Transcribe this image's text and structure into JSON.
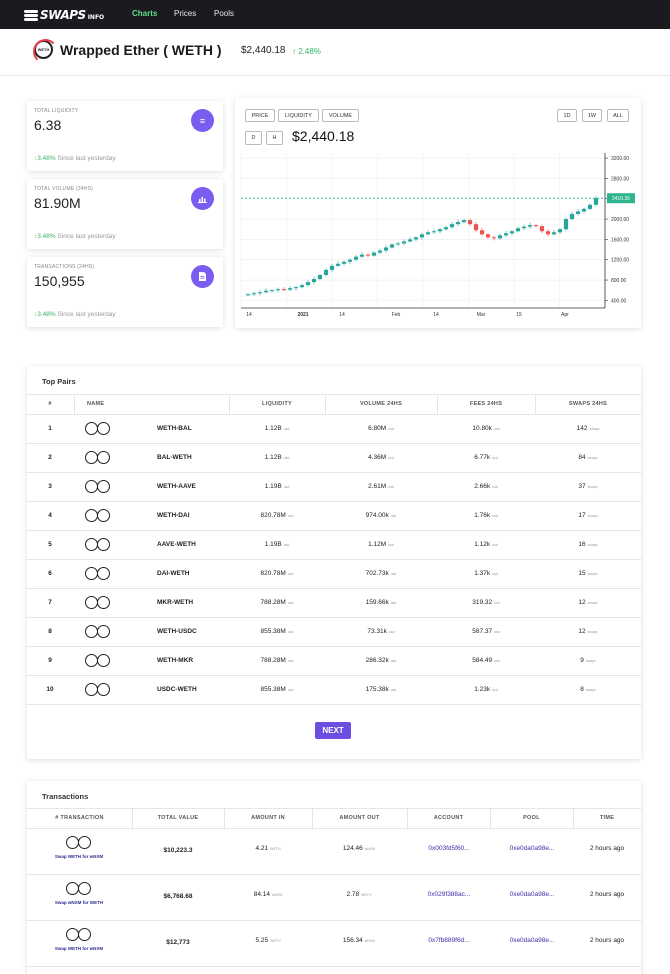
{
  "nav": {
    "brand": "SWAPS",
    "brand_sub": "INFO",
    "links": [
      "Charts",
      "Prices",
      "Pools"
    ]
  },
  "token": {
    "name": "Wrapped Ether ( WETH )",
    "logo_text": "WETH",
    "price": "$2,440.18",
    "change": "2.48%"
  },
  "stats": [
    {
      "label": "TOTAL LIQUIDITY",
      "value": "6.38",
      "delta": "3.48%",
      "since": "Since last yesterday",
      "icon": "menu-icon"
    },
    {
      "label": "TOTAL VOLUME (24HS)",
      "value": "81.90M",
      "delta": "3.48%",
      "since": "Since last yesterday",
      "icon": "bar-chart-icon"
    },
    {
      "label": "TRANSACTIONS (24HS)",
      "value": "150,955",
      "delta": "3.48%",
      "since": "Since last yesterday",
      "icon": "document-icon"
    }
  ],
  "chart": {
    "tabs": [
      "PRICE",
      "LIQUIDITY",
      "VOLUME"
    ],
    "ranges": [
      "1D",
      "1W",
      "ALL"
    ],
    "intervals": [
      "D",
      "H"
    ],
    "price": "$2,440.18",
    "current_label": "2410.35",
    "accent": "#2fb48e"
  },
  "chart_data": {
    "type": "line",
    "subtype": "candlestick",
    "x_ticks": [
      "14",
      "2021",
      "14",
      "Feb",
      "14",
      "Mar",
      "15",
      "Apr"
    ],
    "y_ticks": [
      "3200.00",
      "2800.00",
      "2400.00",
      "2000.00",
      "1600.00",
      "1200.00",
      "800.00",
      "400.00"
    ],
    "ylim": [
      250,
      3300
    ],
    "current_value": 2410.35,
    "series": [
      {
        "values": [
          520,
          540,
          560,
          590,
          600,
          620,
          610,
          640,
          660,
          700,
          760,
          820,
          900,
          1000,
          1080,
          1120,
          1160,
          1200,
          1260,
          1300,
          1280,
          1340,
          1380,
          1440,
          1500,
          1520,
          1560,
          1600,
          1640,
          1700,
          1740,
          1760,
          1800,
          1840,
          1900,
          1940,
          1980,
          1900,
          1780,
          1700,
          1640,
          1620,
          1680,
          1720,
          1760,
          1820,
          1850,
          1880,
          1860,
          1760,
          1700,
          1740,
          1800,
          2000,
          2100,
          2150,
          2200,
          2280,
          2410
        ]
      }
    ],
    "grid": true
  },
  "top_pairs": {
    "title": "Top Pairs",
    "headers": [
      "#",
      "NAME",
      "LIQUIDITY",
      "VOLUME 24HS",
      "FEES 24HS",
      "SWAPS 24HS"
    ],
    "unit": "usd",
    "swaps_unit": "swaps",
    "rows": [
      {
        "rank": "1",
        "name": "WETH-BAL",
        "liquidity": "1.12B",
        "volume": "6.80M",
        "fees": "10.80k",
        "swaps": "142"
      },
      {
        "rank": "2",
        "name": "BAL-WETH",
        "liquidity": "1.12B",
        "volume": "4.36M",
        "fees": "6.77k",
        "swaps": "84"
      },
      {
        "rank": "3",
        "name": "WETH-AAVE",
        "liquidity": "1.19B",
        "volume": "2.61M",
        "fees": "2.66k",
        "swaps": "37"
      },
      {
        "rank": "4",
        "name": "WETH-DAI",
        "liquidity": "820.78M",
        "volume": "974.00k",
        "fees": "1.76k",
        "swaps": "17"
      },
      {
        "rank": "5",
        "name": "AAVE-WETH",
        "liquidity": "1.19B",
        "volume": "1.12M",
        "fees": "1.12k",
        "swaps": "16"
      },
      {
        "rank": "6",
        "name": "DAI-WETH",
        "liquidity": "820.78M",
        "volume": "702.73k",
        "fees": "1.37k",
        "swaps": "15"
      },
      {
        "rank": "7",
        "name": "MKR-WETH",
        "liquidity": "788.28M",
        "volume": "159.66k",
        "fees": "319.32",
        "swaps": "12"
      },
      {
        "rank": "8",
        "name": "WETH-USDC",
        "liquidity": "855.38M",
        "volume": "73.31k",
        "fees": "587.37",
        "swaps": "12"
      },
      {
        "rank": "9",
        "name": "WETH-MKR",
        "liquidity": "788.28M",
        "volume": "286.32k",
        "fees": "584.49",
        "swaps": "9"
      },
      {
        "rank": "10",
        "name": "USDC-WETH",
        "liquidity": "855.38M",
        "volume": "175.38k",
        "fees": "1.23k",
        "swaps": "8"
      }
    ],
    "next_label": "NEXT"
  },
  "transactions": {
    "title": "Transactions",
    "headers": [
      "# TRANSACTION",
      "TOTAL VALUE",
      "AMOUNT IN",
      "AMOUNT OUT",
      "ACCOUNT",
      "POOL",
      "TIME"
    ],
    "rows": [
      {
        "label": "Swap WETH for wNXM",
        "total": "$10,223.3",
        "in": "4.21",
        "in_unit": "WETH",
        "out": "124.46",
        "out_unit": "wNXM",
        "account": "0x003fd5f60...",
        "pool": "0xe0da0a98e...",
        "time": "2 hours ago"
      },
      {
        "label": "Swap wNXM for WETH",
        "total": "$6,768.68",
        "in": "84.14",
        "in_unit": "wNXM",
        "out": "2.78",
        "out_unit": "WETH",
        "account": "0x029f388ac...",
        "pool": "0xe0da0a98e...",
        "time": "2 hours ago"
      },
      {
        "label": "Swap WETH for wNXM",
        "total": "$12,773",
        "in": "5.25",
        "in_unit": "WETH",
        "out": "156.34",
        "out_unit": "wNXM",
        "account": "0x7fb889f6d...",
        "pool": "0xe0da0a98e...",
        "time": "2 hours ago"
      }
    ]
  }
}
